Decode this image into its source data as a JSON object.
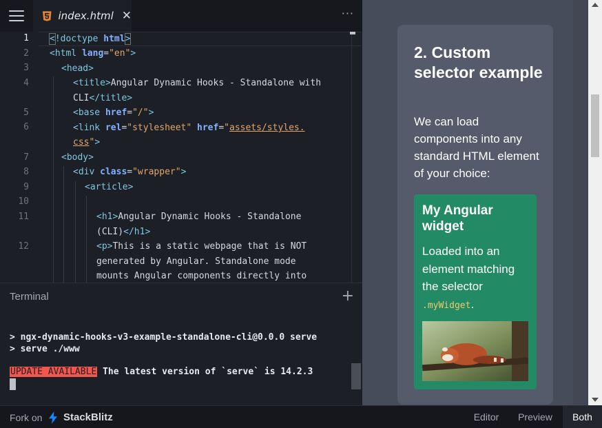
{
  "editor": {
    "tab_label": "index.html",
    "tab_more": "···",
    "line_numbers": [
      "1",
      "2",
      "3",
      "4",
      "",
      "5",
      "6",
      "",
      "7",
      "8",
      "9",
      "10",
      "11",
      "",
      "12",
      "",
      ""
    ],
    "code": {
      "l1_doctype": "!doctype",
      "l1_html": "html",
      "l2_html": "html",
      "l2_attr": "lang",
      "l2_val": "\"en\"",
      "l3_head": "head",
      "l4_title": "title",
      "l4_text": "Angular Dynamic Hooks - Standalone with",
      "l4b_text": "CLI",
      "l4b_close": "/title",
      "l5_base": "base",
      "l5_attr": "href",
      "l5_val": "\"/\"",
      "l6_link": "link",
      "l6_rel": "rel",
      "l6_rel_val": "\"stylesheet\"",
      "l6_href": "href",
      "l6_href_val_a": "assets/styles.",
      "l6_href_val_b": "css",
      "l7_body": "body",
      "l8_div": "div",
      "l8_attr": "class",
      "l8_val": "\"wrapper\"",
      "l9_article": "article",
      "l11_h1": "h1",
      "l11_text": "Angular Dynamic Hooks - Standalone",
      "l11b_text": "(CLI)",
      "l11b_close": "/h1",
      "l12_p": "p",
      "l12_text": "This is a static webpage that is NOT",
      "l12b_text": "generated by Angular. Standalone mode",
      "l12c_text": "mounts Angular components directly into"
    }
  },
  "terminal": {
    "title": "Terminal",
    "add_label": "+",
    "line1": "> ngx-dynamic-hooks-v3-example-standalone-cli@0.0.0 serve",
    "line2": "> serve ./www",
    "update_badge": "UPDATE AVAILABLE",
    "update_text": " The latest version of `serve` is 14.2.3"
  },
  "preview": {
    "card_title": "2. Custom selector example",
    "card_desc": "We can load components into any standard HTML element of your choice:",
    "widget_title": "My Angular widget",
    "widget_desc": "Loaded into an element matching the selector",
    "widget_selector": ".myWidget",
    "widget_period": ".",
    "widget_image": "red-panda-photo"
  },
  "footer": {
    "fork_label": "Fork on",
    "brand": "StackBlitz",
    "views": [
      "Editor",
      "Preview",
      "Both"
    ],
    "active_view": "Both"
  },
  "colors": {
    "accent_bolt": "#1389fd",
    "widget_bg": "#228a65",
    "update_badge_bg": "#f2564d",
    "card_bg": "#555b6b"
  },
  "icons": [
    "menu-icon",
    "html5-icon",
    "close-icon",
    "more-icon",
    "plus-icon",
    "bolt-icon"
  ]
}
